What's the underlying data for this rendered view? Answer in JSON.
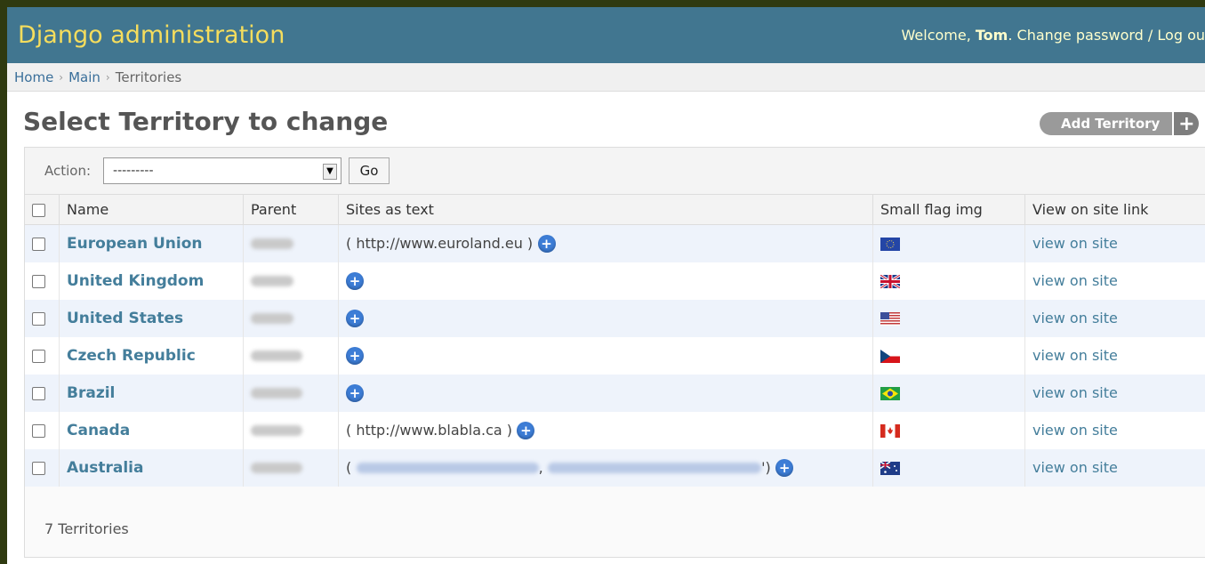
{
  "header": {
    "site_title": "Django administration",
    "welcome_prefix": "Welcome, ",
    "user_name": "Tom",
    "welcome_suffix": ".",
    "change_password": "Change password",
    "separator": "/",
    "logout": "Log ou"
  },
  "breadcrumb": {
    "home": "Home",
    "main": "Main",
    "current": "Territories",
    "sep": "›"
  },
  "page": {
    "title": "Select Territory to change",
    "add_button": "Add Territory",
    "add_plus": "+"
  },
  "actions": {
    "label": "Action:",
    "selected_value": "---------",
    "go_label": "Go"
  },
  "table": {
    "headers": [
      "Name",
      "Parent",
      "Sites as text",
      "Small flag img",
      "View on site link"
    ],
    "rows": [
      {
        "name": "European Union",
        "sites_prefix": "( ",
        "sites_link": "http://www.euroland.eu",
        "sites_suffix": " )",
        "flag": "eu-flag",
        "view": "view on site"
      },
      {
        "name": "United Kingdom",
        "sites_prefix": "",
        "sites_link": "",
        "sites_suffix": "",
        "flag": "uk-flag",
        "view": "view on site"
      },
      {
        "name": "United States",
        "sites_prefix": "",
        "sites_link": "",
        "sites_suffix": "",
        "flag": "us-flag",
        "view": "view on site"
      },
      {
        "name": "Czech Republic",
        "sites_prefix": "",
        "sites_link": "",
        "sites_suffix": "",
        "flag": "czech-flag",
        "view": "view on site"
      },
      {
        "name": "Brazil",
        "sites_prefix": "",
        "sites_link": "",
        "sites_suffix": "",
        "flag": "brazil-flag",
        "view": "view on site"
      },
      {
        "name": "Canada",
        "sites_prefix": "( ",
        "sites_link": "http://www.blabla.ca",
        "sites_suffix": " )",
        "flag": "canada-flag",
        "view": "view on site"
      },
      {
        "name": "Australia",
        "sites_prefix": "(",
        "sites_link": "",
        "sites_suffix": "')",
        "flag": "australia-flag",
        "view": "view on site"
      }
    ]
  },
  "paginator": {
    "count_text": "7 Territories"
  },
  "colors": {
    "header_bg": "#417690",
    "title_yellow": "#f5dd5d",
    "link_blue": "#447e9b",
    "row_alt": "#eef3fb"
  },
  "icons": {
    "add": "plus-circle-icon",
    "select_arrow": "dropdown-arrow-icon"
  }
}
